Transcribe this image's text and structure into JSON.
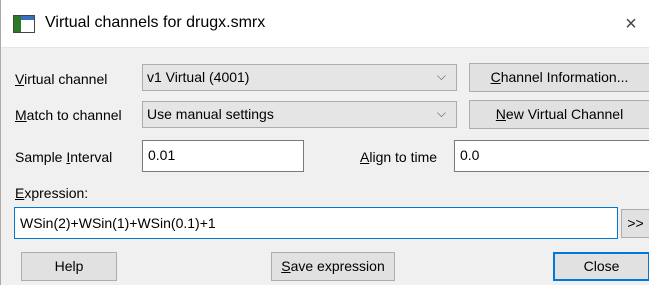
{
  "dialog": {
    "title": "Virtual channels for drugx.smrx",
    "close_symbol": "×",
    "icon": "window-app-icon"
  },
  "virtual_channel": {
    "label_u": "V",
    "label_rest": "irtual channel",
    "value": "v1 Virtual (4001)"
  },
  "match_channel": {
    "label_u": "M",
    "label_rest": "atch to channel",
    "value": "Use manual settings"
  },
  "sample_interval": {
    "label_pre": "Sample ",
    "label_u": "I",
    "label_rest": "nterval",
    "value": "0.01"
  },
  "align_time": {
    "label_u": "A",
    "label_rest": "lign to time",
    "value": "0.0"
  },
  "expression": {
    "label_u": "E",
    "label_rest": "xpression:",
    "value": "WSin(2)+WSin(1)+WSin(0.1)+1",
    "more_button": ">>"
  },
  "buttons": {
    "channel_info_u": "C",
    "channel_info_rest": "hannel Information...",
    "new_virtual_u": "N",
    "new_virtual_rest": "ew Virtual Channel",
    "help": "Help",
    "save_u": "S",
    "save_rest": "ave expression",
    "close": "Close"
  },
  "colors": {
    "dialog_bg": "#f0f0f0",
    "focus_blue": "#0078d7"
  }
}
